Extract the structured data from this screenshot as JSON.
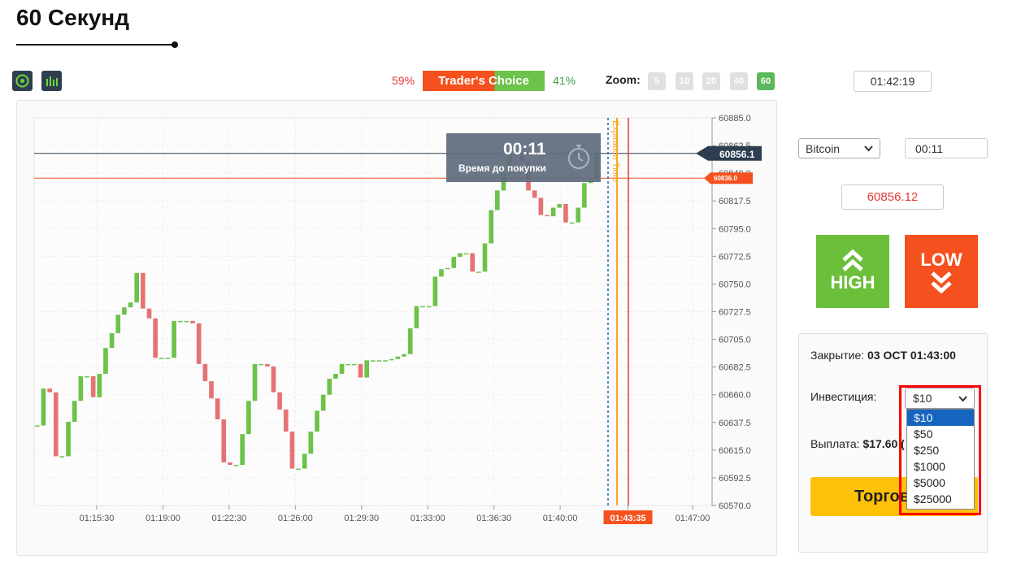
{
  "title": "60 Секунд",
  "traders_choice": {
    "low_pct": "59%",
    "label": "Trader's Choice",
    "high_pct": "41%"
  },
  "zoom": {
    "label": "Zoom:",
    "options": [
      "5",
      "10",
      "20",
      "40",
      "60"
    ],
    "active": "60"
  },
  "clock": "01:42:19",
  "timer": {
    "value": "00:11",
    "label": "Время до покупки"
  },
  "expiration_label": "Expiration Time",
  "asset": "Bitcoin",
  "expiry": "00:11",
  "current_price": "60856.12",
  "buttons": {
    "high": "HIGH",
    "low": "LOW"
  },
  "panel": {
    "close_label": "Закрытие:",
    "close_value": "03 OCT 01:43:00",
    "investment_label": "Инвестиция:",
    "investment_value": "$10",
    "investment_options": [
      "$10",
      "$50",
      "$250",
      "$1000",
      "$5000",
      "$25000"
    ],
    "payout_label": "Выплата:",
    "payout_value": "$17.60 (",
    "trade_button": "Торгов"
  },
  "chart_data": {
    "type": "candlestick",
    "y_ticks": [
      "60885.0",
      "60862.5",
      "60840.0",
      "60817.5",
      "60795.0",
      "60772.5",
      "60750.0",
      "60727.5",
      "60705.0",
      "60682.5",
      "60660.0",
      "60637.5",
      "60615.0",
      "60592.5",
      "60570.0"
    ],
    "ylim": [
      60570.0,
      60885.0
    ],
    "x_ticks": [
      "01:15:30",
      "01:19:00",
      "01:22:30",
      "01:26:00",
      "01:29:30",
      "01:33:00",
      "01:36:30",
      "01:40:00",
      "01:43:35",
      "01:47:00"
    ],
    "x_tick_minutes": [
      0,
      3.5,
      7,
      10.5,
      14,
      17.5,
      21,
      24.5,
      28.083,
      31.5
    ],
    "current_time_label": "01:43:35",
    "current_price_line": {
      "value": 60856.1,
      "label": "60856.1",
      "color": "#2c3e50"
    },
    "strike_line": {
      "value": 60836.0,
      "label": "60836.0",
      "color": "#f4511e"
    },
    "up_color": "#6cc24a",
    "down_color": "#e57373",
    "candles": [
      [
        60635,
        60635
      ],
      [
        60635,
        60665
      ],
      [
        60665,
        60662
      ],
      [
        60662,
        60610
      ],
      [
        60610,
        60610
      ],
      [
        60610,
        60638
      ],
      [
        60638,
        60655
      ],
      [
        60655,
        60675
      ],
      [
        60675,
        60675
      ],
      [
        60675,
        60658
      ],
      [
        60658,
        60677
      ],
      [
        60677,
        60698
      ],
      [
        60698,
        60710
      ],
      [
        60710,
        60725
      ],
      [
        60725,
        60731
      ],
      [
        60731,
        60735
      ],
      [
        60735,
        60759
      ],
      [
        60759,
        60730
      ],
      [
        60730,
        60722
      ],
      [
        60722,
        60690
      ],
      [
        60690,
        60690
      ],
      [
        60690,
        60690
      ],
      [
        60690,
        60720
      ],
      [
        60720,
        60720
      ],
      [
        60720,
        60720
      ],
      [
        60720,
        60718
      ],
      [
        60718,
        60685
      ],
      [
        60685,
        60671
      ],
      [
        60671,
        60657
      ],
      [
        60657,
        60640
      ],
      [
        60640,
        60605
      ],
      [
        60605,
        60603
      ],
      [
        60603,
        60603
      ],
      [
        60603,
        60628
      ],
      [
        60628,
        60655
      ],
      [
        60655,
        60685
      ],
      [
        60685,
        60685
      ],
      [
        60685,
        60683
      ],
      [
        60683,
        60662
      ],
      [
        60662,
        60648
      ],
      [
        60648,
        60630
      ],
      [
        60630,
        60600
      ],
      [
        60600,
        60600
      ],
      [
        60600,
        60612
      ],
      [
        60612,
        60630
      ],
      [
        60630,
        60647
      ],
      [
        60647,
        60660
      ],
      [
        60660,
        60673
      ],
      [
        60673,
        60677
      ],
      [
        60677,
        60685
      ],
      [
        60685,
        60685
      ],
      [
        60685,
        60685
      ],
      [
        60685,
        60674
      ],
      [
        60674,
        60688
      ],
      [
        60688,
        60688
      ],
      [
        60688,
        60688
      ],
      [
        60688,
        60688
      ],
      [
        60688,
        60689
      ],
      [
        60689,
        60691
      ],
      [
        60691,
        60693
      ],
      [
        60693,
        60714
      ],
      [
        60714,
        60732
      ],
      [
        60732,
        60732
      ],
      [
        60732,
        60732
      ],
      [
        60732,
        60756
      ],
      [
        60756,
        60762
      ],
      [
        60762,
        60763
      ],
      [
        60763,
        60772
      ],
      [
        60772,
        60775
      ],
      [
        60775,
        60775
      ],
      [
        60775,
        60760
      ],
      [
        60760,
        60760
      ],
      [
        60760,
        60783
      ],
      [
        60783,
        60810
      ],
      [
        60810,
        60826
      ],
      [
        60826,
        60840
      ],
      [
        60840,
        60855
      ],
      [
        60855,
        60855
      ],
      [
        60855,
        60850
      ],
      [
        60850,
        60826
      ],
      [
        60826,
        60820
      ],
      [
        60820,
        60806
      ],
      [
        60806,
        60805
      ],
      [
        60805,
        60812
      ],
      [
        60812,
        60815
      ],
      [
        60815,
        60800
      ],
      [
        60800,
        60800
      ],
      [
        60800,
        60812
      ],
      [
        60812,
        60832
      ],
      [
        60832,
        60835
      ],
      [
        60835,
        60856
      ]
    ]
  }
}
